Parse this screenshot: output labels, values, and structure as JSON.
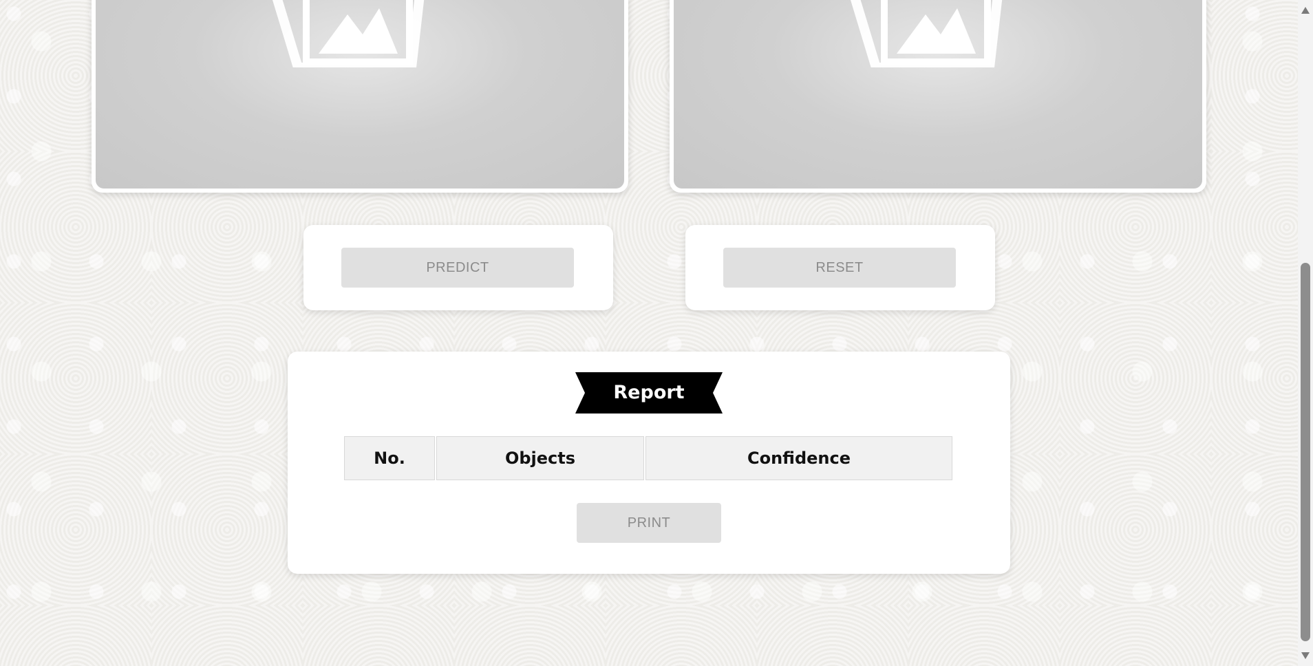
{
  "image_panels": [
    {
      "name": "input-image-placeholder"
    },
    {
      "name": "output-image-placeholder"
    }
  ],
  "buttons": {
    "predict_label": "PREDICT",
    "reset_label": "RESET"
  },
  "report": {
    "title": "Report",
    "columns": [
      "No.",
      "Objects",
      "Confidence"
    ],
    "rows": [],
    "print_label": "PRINT"
  },
  "icons": {
    "image_placeholder": "image-icon",
    "scroll_up": "triangle-up-icon",
    "scroll_down": "triangle-down-icon"
  },
  "colors": {
    "ribbon": "#000000",
    "button_bg": "#e0e0e0",
    "button_text": "#8b8b8b",
    "card_bg": "#ffffff",
    "scroll_thumb": "#8d8d8d"
  }
}
